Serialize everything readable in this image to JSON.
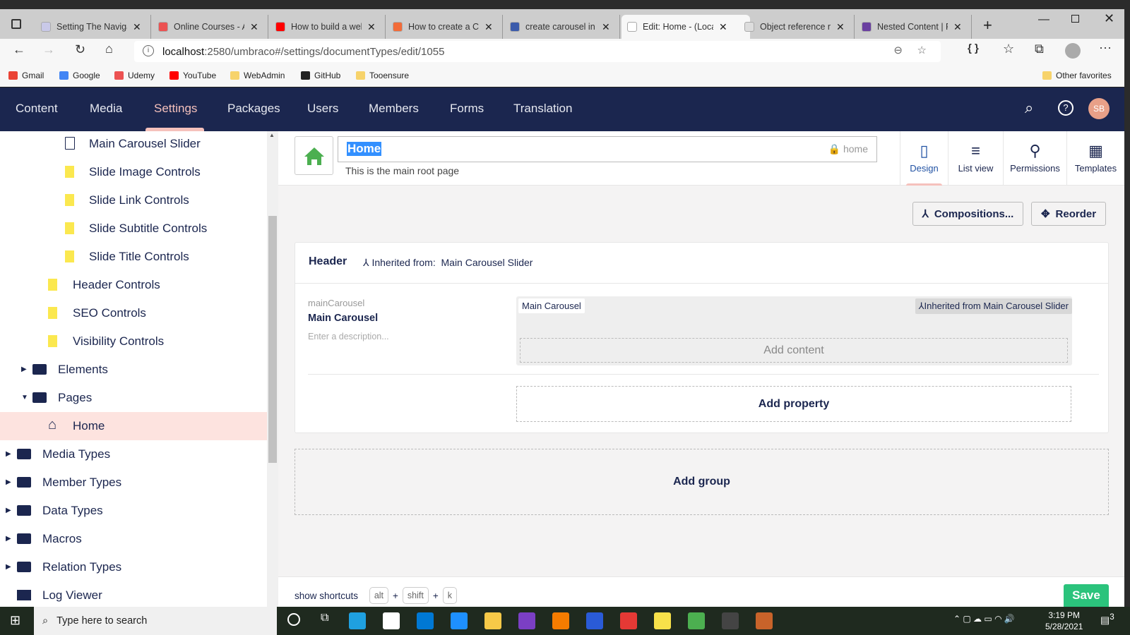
{
  "browser": {
    "tabs": [
      {
        "title": "Setting The Navigation",
        "color": "#c9c9e8"
      },
      {
        "title": "Online Courses - Anytime",
        "color": "#ec5252"
      },
      {
        "title": "How to build a website",
        "color": "#ff0000"
      },
      {
        "title": "How to create a Carousel",
        "color": "#f26b38"
      },
      {
        "title": "create carousel in umbraco",
        "color": "#3b5bab"
      },
      {
        "title": "Edit: Home - (Localhost)",
        "color": "#ffffff",
        "active": true
      },
      {
        "title": "Object reference not set",
        "color": "#dddddd"
      },
      {
        "title": "Nested Content | Perplex",
        "color": "#6a3fa0"
      }
    ],
    "url_host": "localhost",
    "url_rest": ":2580/umbraco#/settings/documentTypes/edit/1055",
    "bookmarks": [
      {
        "label": "Gmail",
        "color": "#ea4335"
      },
      {
        "label": "Google",
        "color": "#4285f4"
      },
      {
        "label": "Udemy",
        "color": "#ec5252"
      },
      {
        "label": "YouTube",
        "color": "#ff0000"
      },
      {
        "label": "WebAdmin",
        "color": "#f7d36b"
      },
      {
        "label": "GitHub",
        "color": "#222222"
      },
      {
        "label": "Tooensure",
        "color": "#f7d36b"
      }
    ],
    "other_favorites": "Other favorites"
  },
  "nav": {
    "items": [
      "Content",
      "Media",
      "Settings",
      "Packages",
      "Users",
      "Members",
      "Forms",
      "Translation"
    ],
    "active": "Settings",
    "avatar": "SB"
  },
  "tree": [
    {
      "label": "Main Carousel Slider",
      "icon": "document"
    },
    {
      "label": "Slide Image Controls",
      "icon": "composition"
    },
    {
      "label": "Slide Link Controls",
      "icon": "composition"
    },
    {
      "label": "Slide Subtitle Controls",
      "icon": "composition"
    },
    {
      "label": "Slide Title Controls",
      "icon": "composition"
    },
    {
      "label": "Header Controls",
      "icon": "composition"
    },
    {
      "label": "SEO Controls",
      "icon": "composition"
    },
    {
      "label": "Visibility Controls",
      "icon": "composition"
    },
    {
      "label": "Elements",
      "icon": "folder"
    },
    {
      "label": "Pages",
      "icon": "folder"
    },
    {
      "label": "Home",
      "icon": "home"
    },
    {
      "label": "Media Types",
      "icon": "folder"
    },
    {
      "label": "Member Types",
      "icon": "folder"
    },
    {
      "label": "Data Types",
      "icon": "folder"
    },
    {
      "label": "Macros",
      "icon": "folder"
    },
    {
      "label": "Relation Types",
      "icon": "folder"
    },
    {
      "label": "Log Viewer",
      "icon": "archive"
    }
  ],
  "editor": {
    "name": "Home",
    "alias": "home",
    "description": "This is the main root page",
    "views": [
      "Design",
      "List view",
      "Permissions",
      "Templates"
    ],
    "compositions": "Compositions...",
    "reorder": "Reorder",
    "group": {
      "title": "Header",
      "inherited_label": "Inherited from:",
      "inherited_from": "Main Carousel Slider"
    },
    "property": {
      "alias": "mainCarousel",
      "name": "Main Carousel",
      "description": "Enter a description...",
      "editor": "Main Carousel",
      "inherited": "Inherited from Main Carousel Slider",
      "add_content": "Add content"
    },
    "add_property": "Add property",
    "add_group": "Add group"
  },
  "footer": {
    "show_shortcuts": "show shortcuts",
    "keys": [
      "alt",
      "shift",
      "k"
    ],
    "plus": "+",
    "save": "Save"
  },
  "taskbar": {
    "search": "Type here to search",
    "time": "3:19 PM",
    "date": "5/28/2021",
    "notifications": "3"
  }
}
